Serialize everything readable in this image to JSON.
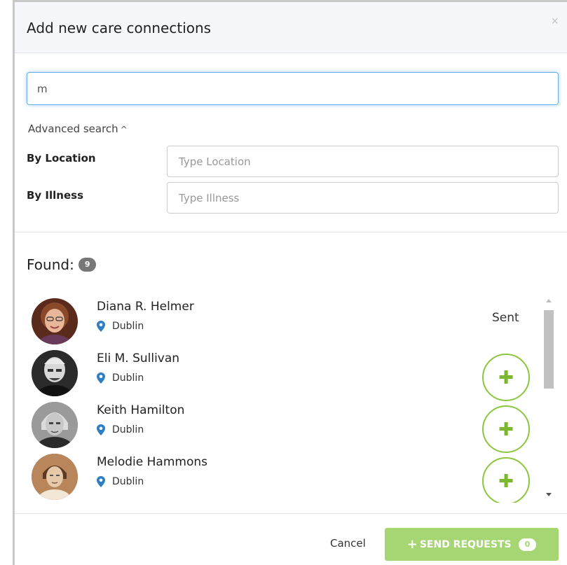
{
  "modal": {
    "title": "Add new care connections",
    "close_label": "×"
  },
  "search": {
    "value": "m",
    "placeholder": ""
  },
  "advanced": {
    "toggle_label": "Advanced search",
    "caret": "^",
    "location_label": "By Location",
    "location_placeholder": "Type Location",
    "illness_label": "By Illness",
    "illness_placeholder": "Type Illness"
  },
  "results": {
    "found_label": "Found:",
    "count": "9",
    "items": [
      {
        "name": "Diana R. Helmer",
        "location": "Dublin",
        "status": "Sent"
      },
      {
        "name": "Eli M. Sullivan",
        "location": "Dublin",
        "status": "add"
      },
      {
        "name": "Keith Hamilton",
        "location": "Dublin",
        "status": "add"
      },
      {
        "name": "Melodie Hammons",
        "location": "Dublin",
        "status": "add"
      }
    ]
  },
  "footer": {
    "cancel_label": "Cancel",
    "send_label": "SEND REQUESTS",
    "send_plus": "+",
    "send_count": "0"
  },
  "colors": {
    "accent_green": "#8cc63f",
    "send_button": "#a5d673",
    "focus_blue": "#66afe9",
    "pin_blue": "#2d7ec3"
  }
}
